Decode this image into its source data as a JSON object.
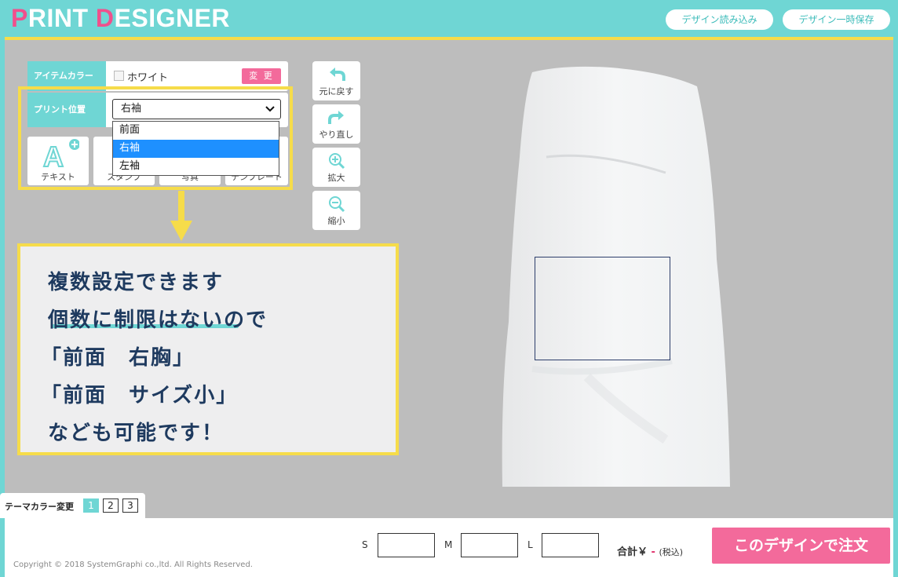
{
  "header": {
    "logo_p": "P",
    "logo_rint": "RINT ",
    "logo_d": "D",
    "logo_esigner": "ESIGNER",
    "load_button": "デザイン読み込み",
    "save_button": "デザイン一時保存"
  },
  "panel": {
    "item_color_label": "アイテムカラー",
    "item_color_value": "ホワイト",
    "change_button": "変 更",
    "print_position_label": "プリント位置",
    "print_position_selected": "右袖",
    "print_position_options": [
      "前面",
      "右袖",
      "左袖"
    ],
    "tools": [
      {
        "label": "テキスト",
        "icon": "text-add-icon"
      },
      {
        "label": "スタンプ",
        "icon": "stamp-icon"
      },
      {
        "label": "写真",
        "icon": "photo-icon"
      },
      {
        "label": "テンプレート",
        "icon": "template-icon"
      }
    ]
  },
  "side_toolbar": {
    "undo": "元に戻す",
    "redo": "やり直し",
    "zoom_in": "拡大",
    "zoom_out": "縮小"
  },
  "callout": {
    "lines": [
      "複数設定できます",
      "個数に制限はないので",
      "「前面　右胸」",
      "「前面　サイズ小」",
      "なども可能です！"
    ]
  },
  "theme": {
    "label": "テーマカラー変更",
    "options": [
      "1",
      "2",
      "3"
    ],
    "active": "1"
  },
  "footer": {
    "copyright": "Copyright © 2018 SystemGraphi co.,ltd. All Rights Reserved.",
    "sizes": [
      "S",
      "M",
      "L"
    ],
    "total_label": "合計￥",
    "total_value": "-",
    "tax_note": "(税込)",
    "order_button": "このデザインで注文"
  },
  "colors": {
    "accent": "#6fd6d4",
    "pink": "#f36a9b",
    "highlight": "#f6dc4a",
    "callout_text": "#1e3a5f"
  }
}
